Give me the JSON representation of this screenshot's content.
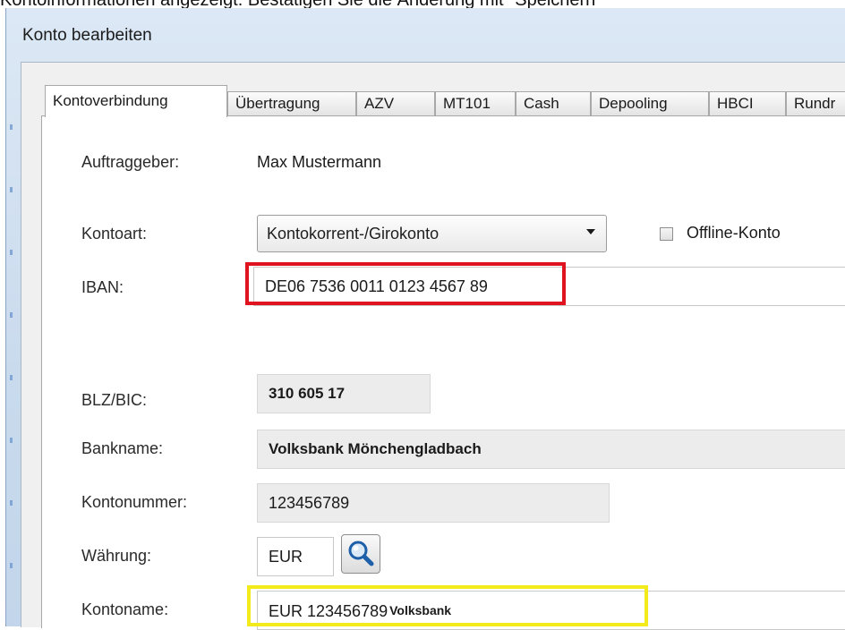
{
  "caption": "Kontoinformationen angezeigt. Bestätigen Sie die Änderung mit \"Speichern\"",
  "window": {
    "title": "Konto bearbeiten"
  },
  "tabs": [
    {
      "label": "Kontoverbindung",
      "active": true
    },
    {
      "label": "Übertragung",
      "active": false
    },
    {
      "label": "AZV",
      "active": false
    },
    {
      "label": "MT101",
      "active": false
    },
    {
      "label": "Cash",
      "active": false
    },
    {
      "label": "Depooling",
      "active": false
    },
    {
      "label": "HBCI",
      "active": false
    },
    {
      "label": "Rundr",
      "active": false
    }
  ],
  "form": {
    "auftraggeber": {
      "label": "Auftraggeber:",
      "value": "Max Mustermann"
    },
    "kontoart": {
      "label": "Kontoart:",
      "value": "Kontokorrent-/Girokonto"
    },
    "offline": {
      "label": "Offline-Konto",
      "checked": false
    },
    "iban": {
      "label": "IBAN:",
      "value": "DE06 7536 0011 0123 4567 89"
    },
    "blz_bic": {
      "label": "BLZ/BIC:",
      "value": "310 605 17"
    },
    "bankname": {
      "label": "Bankname:",
      "value": "Volksbank Mönchengladbach"
    },
    "kontonummer": {
      "label": "Kontonummer:",
      "value": "123456789"
    },
    "waehrung": {
      "label": "Währung:",
      "value": "EUR"
    },
    "kontoname": {
      "label": "Kontoname:",
      "value": "EUR 123456789",
      "suffix": "Volksbank"
    }
  },
  "icons": {
    "search": "magnifier-icon",
    "dropdown": "chevron-down-icon"
  },
  "highlights": {
    "iban": "#e0141e",
    "kontoname": "#f3ea1c"
  }
}
